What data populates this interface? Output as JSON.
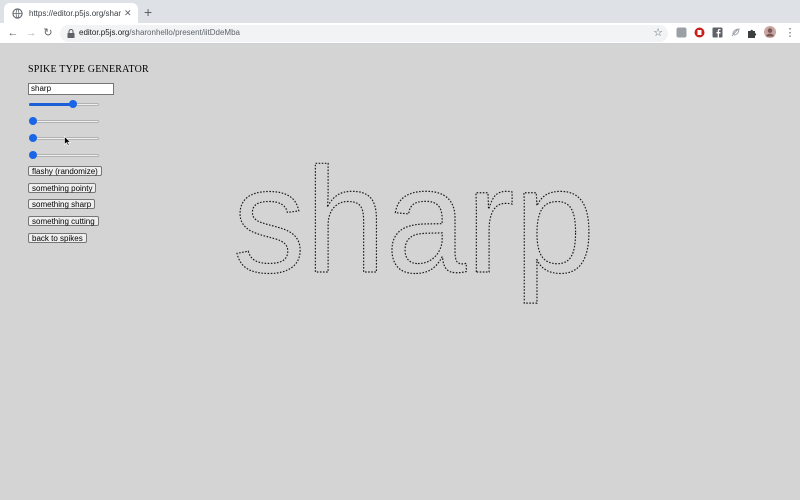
{
  "browser": {
    "tab_title": "https://editor.p5js.org/sharonhello/present/iitDdeMba",
    "url_host": "editor.p5js.org",
    "url_path": "/sharonhello/present/iitDdeMba",
    "icons": [
      "globe-icon",
      "close-icon",
      "plus-icon",
      "back-arrow-icon",
      "forward-arrow-icon",
      "reload-icon",
      "lock-icon",
      "star-icon",
      "extension-icons",
      "puzzle-icon",
      "profile-avatar",
      "menu-dots-icon"
    ]
  },
  "app": {
    "title": "SPIKE TYPE GENERATOR",
    "text_value": "sharp",
    "sliders": [
      {
        "value_fraction": 0.65
      },
      {
        "value_fraction": 0.0
      },
      {
        "value_fraction": 0.0
      },
      {
        "value_fraction": 0.0
      }
    ],
    "buttons": [
      "flashy (randomize)",
      "something pointy",
      "something sharp",
      "something cutting",
      "back to spikes"
    ],
    "artwork_text": "sharp",
    "colors": {
      "canvas_bg": "#d4d4d4",
      "slider_accent": "#1a66e6",
      "outline": "#1a1a1a"
    }
  }
}
